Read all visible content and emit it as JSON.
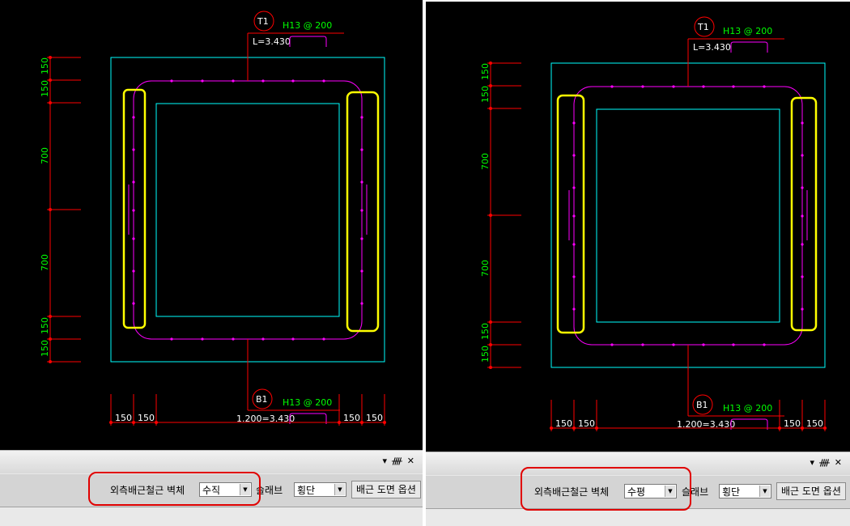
{
  "left": {
    "top_label": "T1",
    "top_callout": "H13 @ 200",
    "top_length": "L=3.430",
    "bottom_label": "B1",
    "bottom_callout": "H13 @ 200",
    "bottom_length": "1.200=3.430",
    "vdims": [
      "150",
      "150",
      "700",
      "700",
      "150",
      "150"
    ],
    "hdims": [
      "150",
      "150",
      "150",
      "150"
    ],
    "wall_label": "외측배근철근 벽체",
    "wall_value": "수직",
    "slab_label": "슬래브",
    "slab_value": "횡단",
    "options_button": "배근 도면 옵션"
  },
  "right": {
    "top_label": "T1",
    "top_callout": "H13 @ 200",
    "top_length": "L=3.430",
    "bottom_label": "B1",
    "bottom_callout": "H13 @ 200",
    "bottom_length": "1.200=3.430",
    "vdims": [
      "150",
      "150",
      "700",
      "700",
      "150",
      "150"
    ],
    "hdims": [
      "150",
      "150",
      "150",
      "150"
    ],
    "wall_label": "외측배근철근 벽체",
    "wall_value": "수평",
    "slab_label": "슬래브",
    "slab_value": "횡단",
    "options_button": "배근 도면 옵션"
  },
  "colors": {
    "outline": "#00ffff",
    "rebar": "#ff00ff",
    "dimension": "#ff0000",
    "dimension_text": "#00ff00",
    "highlight_yellow": "#ffff00",
    "highlight_red": "#e00000"
  },
  "icons": [
    "pin-icon",
    "close-icon",
    "dropdown-arrow-icon"
  ]
}
